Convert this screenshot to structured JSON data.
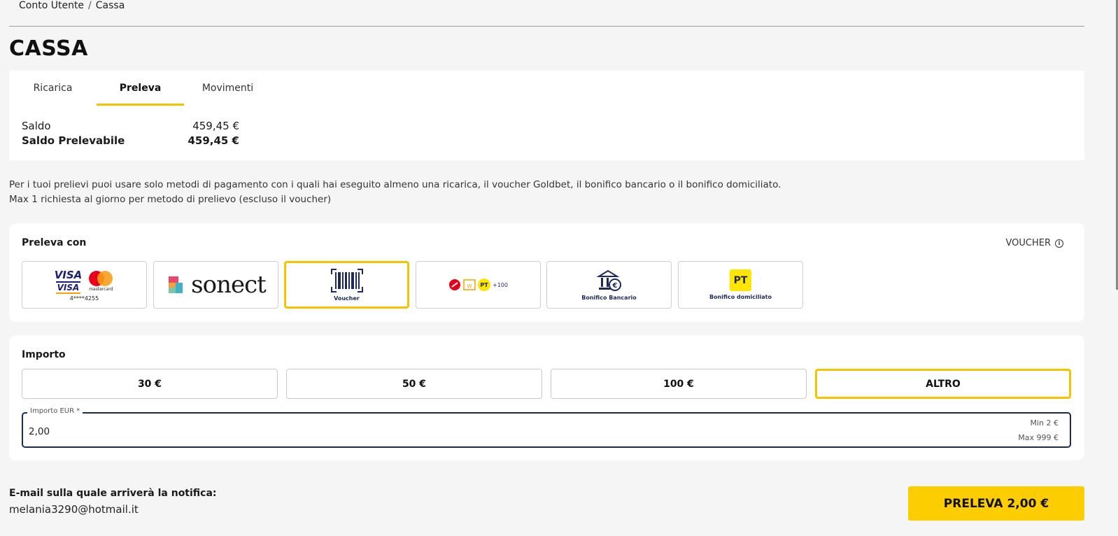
{
  "breadcrumb": {
    "item1": "Conto Utente",
    "separator": "/",
    "item2": "Cassa"
  },
  "page_title": "CASSA",
  "tabs": [
    {
      "label": "Ricarica",
      "active": false
    },
    {
      "label": "Preleva",
      "active": true
    },
    {
      "label": "Movimenti",
      "active": false
    }
  ],
  "balance": {
    "saldo_label": "Saldo",
    "saldo_value": "459,45 €",
    "prelevabile_label": "Saldo Prelevabile",
    "prelevabile_value": "459,45 €"
  },
  "info": {
    "line1": "Per i tuoi prelievi puoi usare solo metodi di pagamento con i quali hai eseguito almeno una ricarica, il voucher Goldbet, il bonifico bancario o il bonifico domiciliato.",
    "line2": "Max 1 richiesta al giorno per metodo di prelievo (escluso il voucher)"
  },
  "preleva": {
    "title": "Preleva con",
    "selected_method_label": "VOUCHER",
    "methods": [
      {
        "id": "card",
        "brand1": "VISA",
        "brand2": "VISA",
        "brand3": "mastercard",
        "label": "4****4255"
      },
      {
        "id": "sonect",
        "label": "sonect"
      },
      {
        "id": "voucher",
        "label": "Voucher",
        "selected": true
      },
      {
        "id": "multi",
        "label": "+100",
        "badge": "PT"
      },
      {
        "id": "bonifico",
        "label": "Bonifico Bancario"
      },
      {
        "id": "domiciliato",
        "label": "Bonifico domiciliato",
        "badge": "PT"
      }
    ]
  },
  "importo": {
    "title": "Importo",
    "buttons": [
      {
        "label": "30 €",
        "selected": false
      },
      {
        "label": "50 €",
        "selected": false
      },
      {
        "label": "100 €",
        "selected": false
      },
      {
        "label": "ALTRO",
        "selected": true
      }
    ],
    "field_label": "Importo EUR *",
    "field_value": "2,00",
    "min_hint": "Min 2 €",
    "max_hint": "Max 999 €"
  },
  "email": {
    "label": "E-mail sulla quale arriverà la notifica:",
    "value": "melania3290@hotmail.it"
  },
  "submit_label": "PRELEVA 2,00 €",
  "colors": {
    "accent": "#f4c400",
    "button": "#fccd00",
    "navy": "#1b2a4e"
  }
}
